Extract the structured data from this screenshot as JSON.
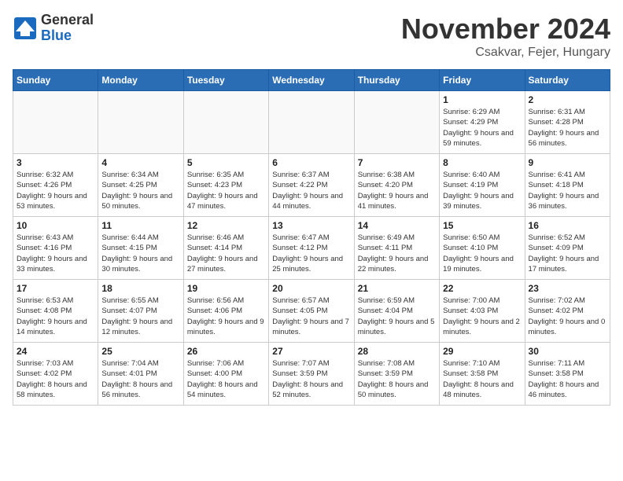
{
  "header": {
    "logo_general": "General",
    "logo_blue": "Blue",
    "month_title": "November 2024",
    "location": "Csakvar, Fejer, Hungary"
  },
  "weekdays": [
    "Sunday",
    "Monday",
    "Tuesday",
    "Wednesday",
    "Thursday",
    "Friday",
    "Saturday"
  ],
  "weeks": [
    [
      {
        "day": "",
        "info": ""
      },
      {
        "day": "",
        "info": ""
      },
      {
        "day": "",
        "info": ""
      },
      {
        "day": "",
        "info": ""
      },
      {
        "day": "",
        "info": ""
      },
      {
        "day": "1",
        "info": "Sunrise: 6:29 AM\nSunset: 4:29 PM\nDaylight: 9 hours and 59 minutes."
      },
      {
        "day": "2",
        "info": "Sunrise: 6:31 AM\nSunset: 4:28 PM\nDaylight: 9 hours and 56 minutes."
      }
    ],
    [
      {
        "day": "3",
        "info": "Sunrise: 6:32 AM\nSunset: 4:26 PM\nDaylight: 9 hours and 53 minutes."
      },
      {
        "day": "4",
        "info": "Sunrise: 6:34 AM\nSunset: 4:25 PM\nDaylight: 9 hours and 50 minutes."
      },
      {
        "day": "5",
        "info": "Sunrise: 6:35 AM\nSunset: 4:23 PM\nDaylight: 9 hours and 47 minutes."
      },
      {
        "day": "6",
        "info": "Sunrise: 6:37 AM\nSunset: 4:22 PM\nDaylight: 9 hours and 44 minutes."
      },
      {
        "day": "7",
        "info": "Sunrise: 6:38 AM\nSunset: 4:20 PM\nDaylight: 9 hours and 41 minutes."
      },
      {
        "day": "8",
        "info": "Sunrise: 6:40 AM\nSunset: 4:19 PM\nDaylight: 9 hours and 39 minutes."
      },
      {
        "day": "9",
        "info": "Sunrise: 6:41 AM\nSunset: 4:18 PM\nDaylight: 9 hours and 36 minutes."
      }
    ],
    [
      {
        "day": "10",
        "info": "Sunrise: 6:43 AM\nSunset: 4:16 PM\nDaylight: 9 hours and 33 minutes."
      },
      {
        "day": "11",
        "info": "Sunrise: 6:44 AM\nSunset: 4:15 PM\nDaylight: 9 hours and 30 minutes."
      },
      {
        "day": "12",
        "info": "Sunrise: 6:46 AM\nSunset: 4:14 PM\nDaylight: 9 hours and 27 minutes."
      },
      {
        "day": "13",
        "info": "Sunrise: 6:47 AM\nSunset: 4:12 PM\nDaylight: 9 hours and 25 minutes."
      },
      {
        "day": "14",
        "info": "Sunrise: 6:49 AM\nSunset: 4:11 PM\nDaylight: 9 hours and 22 minutes."
      },
      {
        "day": "15",
        "info": "Sunrise: 6:50 AM\nSunset: 4:10 PM\nDaylight: 9 hours and 19 minutes."
      },
      {
        "day": "16",
        "info": "Sunrise: 6:52 AM\nSunset: 4:09 PM\nDaylight: 9 hours and 17 minutes."
      }
    ],
    [
      {
        "day": "17",
        "info": "Sunrise: 6:53 AM\nSunset: 4:08 PM\nDaylight: 9 hours and 14 minutes."
      },
      {
        "day": "18",
        "info": "Sunrise: 6:55 AM\nSunset: 4:07 PM\nDaylight: 9 hours and 12 minutes."
      },
      {
        "day": "19",
        "info": "Sunrise: 6:56 AM\nSunset: 4:06 PM\nDaylight: 9 hours and 9 minutes."
      },
      {
        "day": "20",
        "info": "Sunrise: 6:57 AM\nSunset: 4:05 PM\nDaylight: 9 hours and 7 minutes."
      },
      {
        "day": "21",
        "info": "Sunrise: 6:59 AM\nSunset: 4:04 PM\nDaylight: 9 hours and 5 minutes."
      },
      {
        "day": "22",
        "info": "Sunrise: 7:00 AM\nSunset: 4:03 PM\nDaylight: 9 hours and 2 minutes."
      },
      {
        "day": "23",
        "info": "Sunrise: 7:02 AM\nSunset: 4:02 PM\nDaylight: 9 hours and 0 minutes."
      }
    ],
    [
      {
        "day": "24",
        "info": "Sunrise: 7:03 AM\nSunset: 4:02 PM\nDaylight: 8 hours and 58 minutes."
      },
      {
        "day": "25",
        "info": "Sunrise: 7:04 AM\nSunset: 4:01 PM\nDaylight: 8 hours and 56 minutes."
      },
      {
        "day": "26",
        "info": "Sunrise: 7:06 AM\nSunset: 4:00 PM\nDaylight: 8 hours and 54 minutes."
      },
      {
        "day": "27",
        "info": "Sunrise: 7:07 AM\nSunset: 3:59 PM\nDaylight: 8 hours and 52 minutes."
      },
      {
        "day": "28",
        "info": "Sunrise: 7:08 AM\nSunset: 3:59 PM\nDaylight: 8 hours and 50 minutes."
      },
      {
        "day": "29",
        "info": "Sunrise: 7:10 AM\nSunset: 3:58 PM\nDaylight: 8 hours and 48 minutes."
      },
      {
        "day": "30",
        "info": "Sunrise: 7:11 AM\nSunset: 3:58 PM\nDaylight: 8 hours and 46 minutes."
      }
    ]
  ]
}
